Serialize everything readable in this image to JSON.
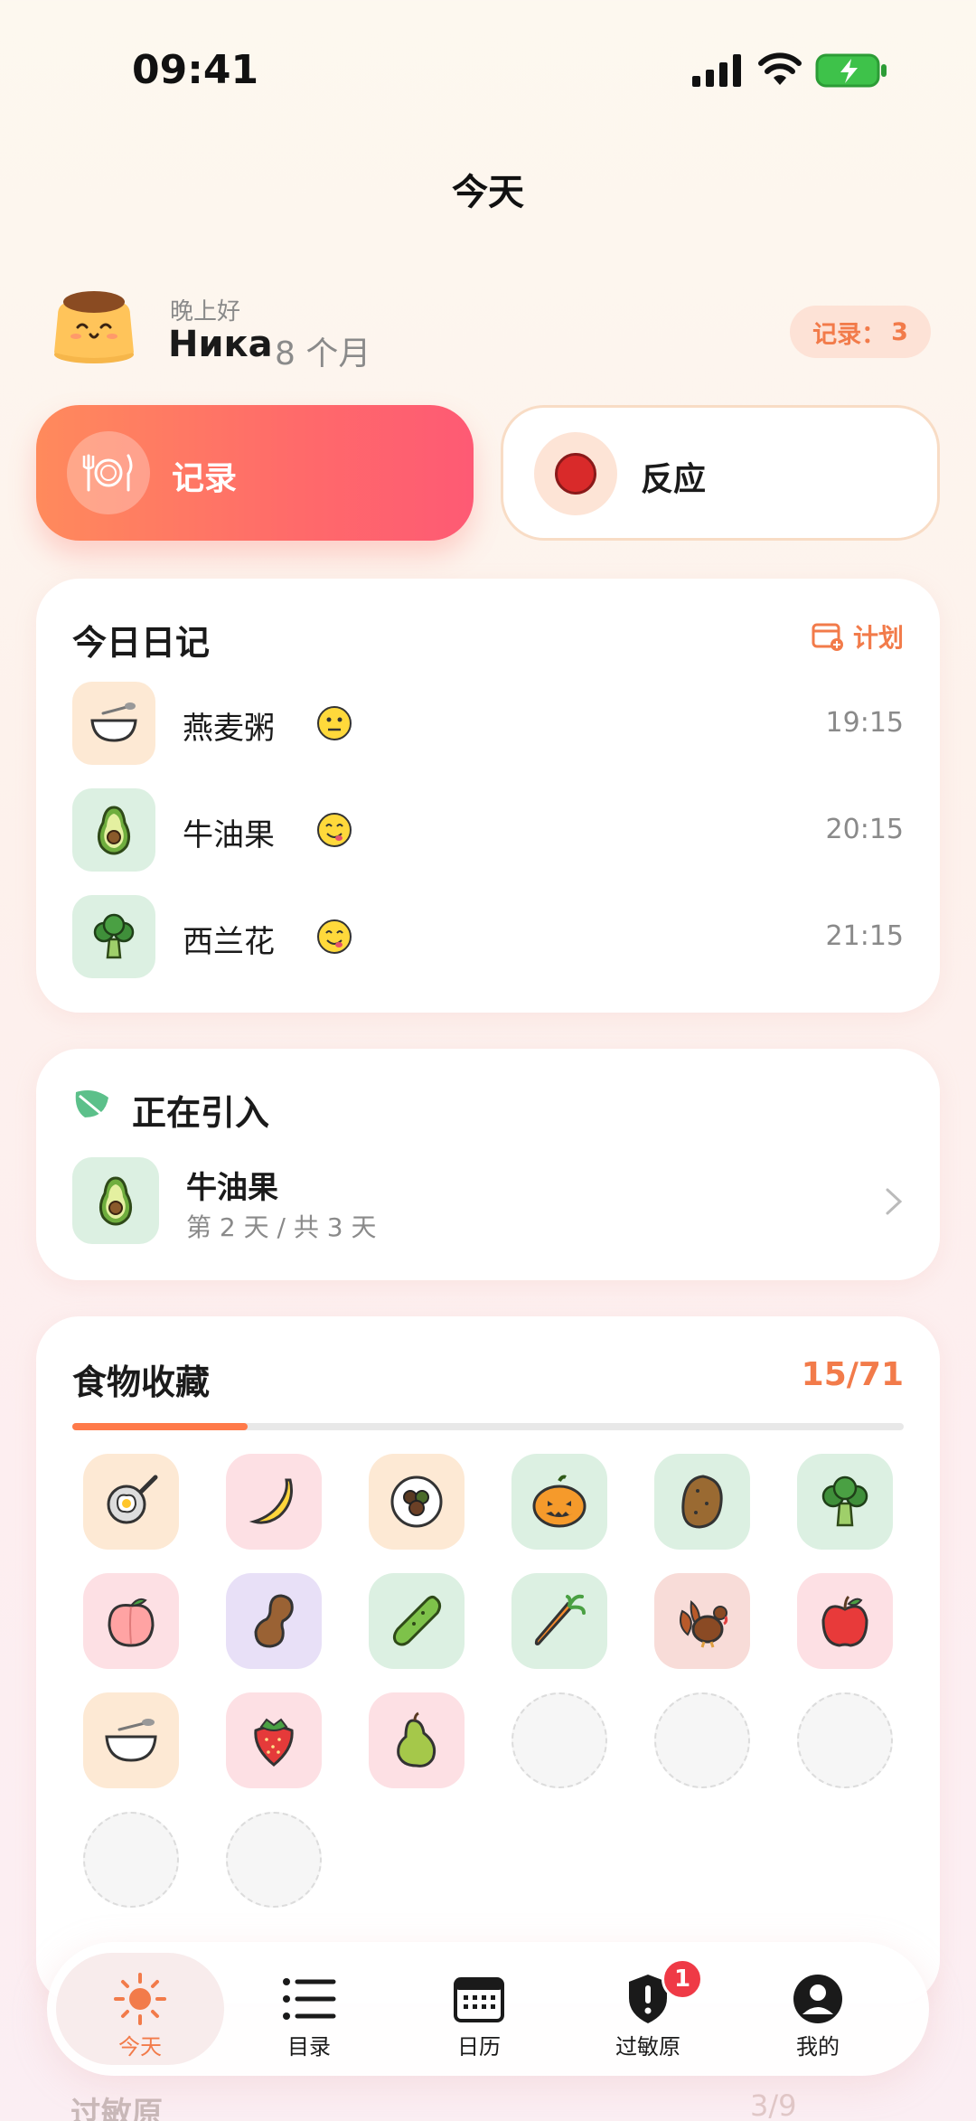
{
  "status_bar": {
    "time": "09:41"
  },
  "nav": {
    "title": "今天"
  },
  "greeting": {
    "salutation": "晚上好",
    "name": "Ника",
    "age": "8 个月",
    "records_label": "记录：",
    "records_count": "3"
  },
  "actions": {
    "record_label": "记录",
    "reaction_label": "反应"
  },
  "diary": {
    "title": "今日日记",
    "plan_label": "计划",
    "entries": [
      {
        "name": "燕麦粥",
        "time": "19:15",
        "reaction": "neutral-face-icon",
        "icon": "porridge-bowl-icon"
      },
      {
        "name": "牛油果",
        "time": "20:15",
        "reaction": "yummy-face-icon",
        "icon": "avocado-icon"
      },
      {
        "name": "西兰花",
        "time": "21:15",
        "reaction": "yummy-face-icon",
        "icon": "broccoli-icon"
      }
    ]
  },
  "introducing": {
    "title": "正在引入",
    "food": "牛油果",
    "progress_text": "第 2 天 / 共 3 天"
  },
  "collection": {
    "title": "食物收藏",
    "count": "15/71",
    "progress_fraction": 0.211,
    "items": [
      {
        "icon": "fried-egg-icon",
        "bg": "peach"
      },
      {
        "icon": "banana-icon",
        "bg": "pink"
      },
      {
        "icon": "beans-plate-icon",
        "bg": "peach"
      },
      {
        "icon": "pumpkin-icon",
        "bg": "green"
      },
      {
        "icon": "potato-icon",
        "bg": "green"
      },
      {
        "icon": "broccoli-icon",
        "bg": "green"
      },
      {
        "icon": "peach-icon",
        "bg": "pink"
      },
      {
        "icon": "peanut-icon",
        "bg": "lav"
      },
      {
        "icon": "cucumber-icon",
        "bg": "green"
      },
      {
        "icon": "carrot-icon",
        "bg": "green"
      },
      {
        "icon": "turkey-icon",
        "bg": "rose"
      },
      {
        "icon": "apple-icon",
        "bg": "pink"
      },
      {
        "icon": "porridge-bowl-icon",
        "bg": "peach"
      },
      {
        "icon": "strawberry-icon",
        "bg": "pink"
      },
      {
        "icon": "pear-icon",
        "bg": "pink"
      }
    ],
    "empty_slots": 5
  },
  "peek": {
    "title": "过敏原",
    "right": "3/9"
  },
  "tabs": [
    {
      "label": "今天",
      "icon": "sun-icon",
      "active": true
    },
    {
      "label": "目录",
      "icon": "list-icon"
    },
    {
      "label": "日历",
      "icon": "calendar-icon"
    },
    {
      "label": "过敏原",
      "icon": "shield-alert-icon",
      "badge": "1"
    },
    {
      "label": "我的",
      "icon": "profile-icon"
    }
  ],
  "colors": {
    "accent": "#f27b4a",
    "record_gradient_start": "#ff8a5c",
    "record_gradient_end": "#fe5a74",
    "badge_red": "#ef3a46"
  }
}
